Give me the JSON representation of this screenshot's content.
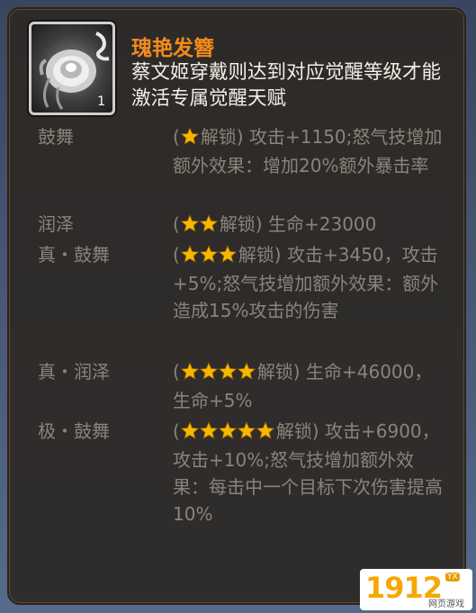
{
  "item": {
    "icon": "white-peony-hairpin-icon",
    "count": "1",
    "name": "瑰艳发簪",
    "description": "蔡文姬穿戴则达到对应觉醒等级才能激活专属觉醒天赋"
  },
  "colors": {
    "title": "#f28a1a",
    "description": "#f2efe6",
    "locked_text": "#8a847a",
    "star": "#f5b700"
  },
  "talents": [
    {
      "name": "鼓舞",
      "stars": 1,
      "prefix": "(",
      "unlock_label": "解锁)",
      "effect": " 攻击+1150;怒气技增加额外效果：增加20%额外暴击率"
    },
    {
      "name": "润泽",
      "stars": 2,
      "prefix": "(",
      "unlock_label": "解锁)",
      "effect": " 生命+23000"
    },
    {
      "name": "真・鼓舞",
      "stars": 3,
      "prefix": "(",
      "unlock_label": "解锁)",
      "effect": " 攻击+3450，攻击+5%;怒气技增加额外效果：额外造成15%攻击的伤害"
    },
    {
      "name": "真・润泽",
      "stars": 4,
      "prefix": "(",
      "unlock_label": "解锁)",
      "effect": " 生命+46000，生命+5%"
    },
    {
      "name": "极・鼓舞",
      "stars": 5,
      "prefix": "(",
      "unlock_label": "解锁)",
      "effect": " 攻击+6900，攻击+10%;怒气技增加额外效果：每击中一个目标下次伤害提高10%"
    }
  ],
  "watermark": {
    "logo": "1912",
    "tag": "YX",
    "subtitle": "网页游戏"
  }
}
